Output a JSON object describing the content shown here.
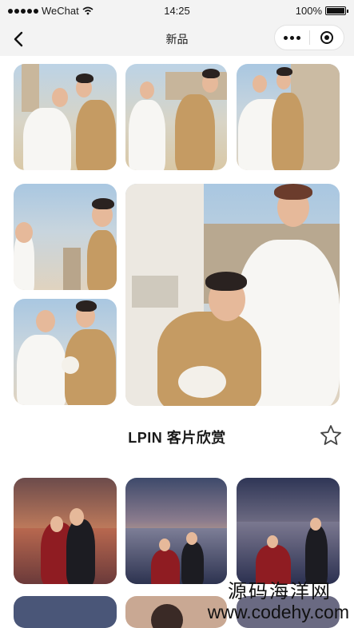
{
  "status_bar": {
    "carrier": "WeChat",
    "time": "14:25",
    "battery": "100%",
    "battery_level": 1.0
  },
  "nav": {
    "title": "新品",
    "back_icon": "chevron-left-icon",
    "more_icon": "more-dots-icon",
    "close_icon": "target-circle-icon"
  },
  "section": {
    "title": "LPIN 客片欣赏",
    "star_icon": "star-outline-icon"
  },
  "watermark": {
    "line1": "源码海洋网",
    "line2": "www.codehy.com"
  },
  "gallery_top": [
    {
      "scene": "couple-kiss-bridge"
    },
    {
      "scene": "couple-walking-hand-in-hand"
    },
    {
      "scene": "couple-with-bouquet-building"
    },
    {
      "scene": "couple-face-to-face-clock-tower"
    },
    {
      "scene": "groom-holding-bouquet-bride-behind"
    },
    {
      "scene": "bride-and-groom-large-portrait"
    }
  ],
  "gallery_bottom": [
    {
      "scene": "couple-embrace-sunset-sea"
    },
    {
      "scene": "couple-sparklers-lake"
    },
    {
      "scene": "couple-sparklers-dusk"
    }
  ]
}
